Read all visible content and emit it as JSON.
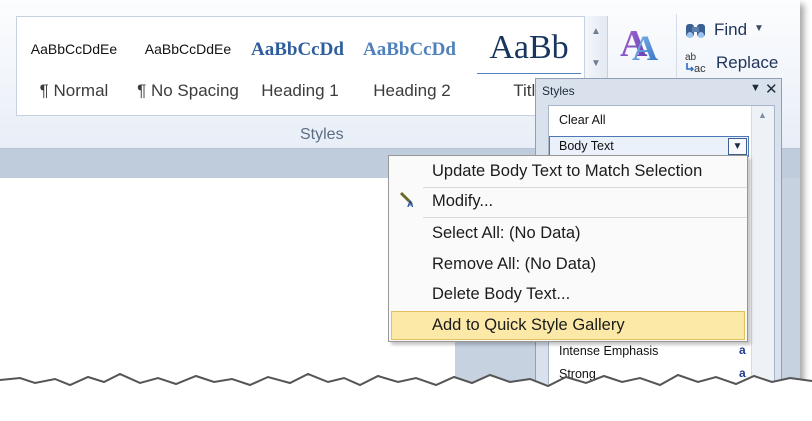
{
  "gallery": {
    "items": [
      {
        "sample": "AaBbCcDdEe",
        "label": "¶ Normal"
      },
      {
        "sample": "AaBbCcDdEe",
        "label": "¶ No Spacing"
      },
      {
        "sample": "AaBbCcDd",
        "label": "Heading 1"
      },
      {
        "sample": "AaBbCcDd",
        "label": "Heading 2"
      },
      {
        "sample": "AaBb",
        "label": "Title"
      }
    ],
    "group_label": "Styles"
  },
  "editing": {
    "find_label": "Find",
    "replace_label": "Replace"
  },
  "styles_pane": {
    "title": "Styles",
    "items": [
      {
        "label": "Clear All"
      },
      {
        "label": "Body Text"
      },
      {
        "label": "Intense Emphasis",
        "marker": "a"
      },
      {
        "label": "Strong",
        "marker": "a"
      }
    ]
  },
  "context_menu": {
    "items": [
      {
        "label": "Update Body Text to Match Selection"
      },
      {
        "label": "Modify..."
      },
      {
        "label": "Select All: (No Data)"
      },
      {
        "label": "Remove All: (No Data)"
      },
      {
        "label": "Delete Body Text..."
      },
      {
        "label": "Add to Quick Style Gallery"
      }
    ],
    "highlighted": "Add to Quick Style Gallery"
  },
  "colors": {
    "heading_blue": "#2e5e9e",
    "highlight": "#fce8a7",
    "pane_bg": "#d8e1ec"
  }
}
